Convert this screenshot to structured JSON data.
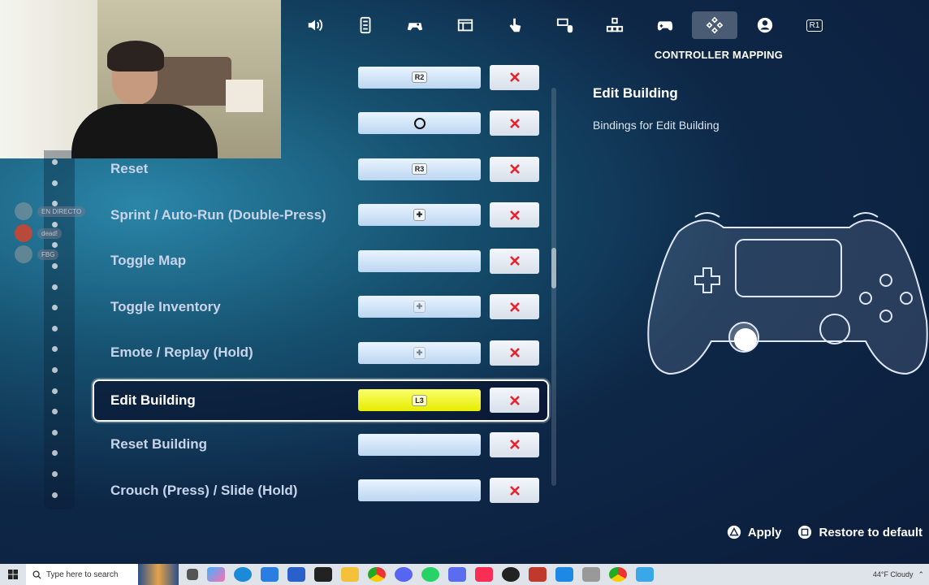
{
  "header": {
    "tab_title": "CONTROLLER MAPPING",
    "tabs": [
      {
        "name": "audio-tab",
        "icon": "speaker-icon"
      },
      {
        "name": "accessibility-tab",
        "icon": "accessibility-icon"
      },
      {
        "name": "input-tab",
        "icon": "gamepad-touch-icon"
      },
      {
        "name": "game-ui-tab",
        "icon": "window-icon"
      },
      {
        "name": "touch-tab",
        "icon": "touch-hand-icon"
      },
      {
        "name": "keyboard-mouse-tab",
        "icon": "keyboard-mouse-icon"
      },
      {
        "name": "hud-tab",
        "icon": "blocks-icon"
      },
      {
        "name": "controller-tab",
        "icon": "gamepad-icon"
      },
      {
        "name": "controller-mapping-tab",
        "icon": "gamepad-mapping-icon",
        "active": true
      },
      {
        "name": "account-tab",
        "icon": "account-icon"
      }
    ],
    "r1_label": "R1"
  },
  "bindings": [
    {
      "label": "",
      "key": "R2",
      "key_style": "badge"
    },
    {
      "label": "",
      "key": "",
      "key_style": "circle"
    },
    {
      "label": "Reset",
      "key": "R3",
      "key_style": "badge"
    },
    {
      "label": "Sprint / Auto-Run (Double-Press)",
      "key": "",
      "key_style": "dpad"
    },
    {
      "label": "Toggle Map",
      "key": "",
      "key_style": "none"
    },
    {
      "label": "Toggle Inventory",
      "key": "",
      "key_style": "dpad-faint"
    },
    {
      "label": "Emote / Replay (Hold)",
      "key": "",
      "key_style": "dpad-faint"
    },
    {
      "label": "Edit Building",
      "key": "L3",
      "key_style": "badge",
      "selected": true
    },
    {
      "label": "Reset Building",
      "key": "",
      "key_style": "none"
    },
    {
      "label": "Crouch (Press) / Slide (Hold)",
      "key": "",
      "key_style": "none"
    }
  ],
  "info": {
    "title": "Edit Building",
    "description": "Bindings for Edit Building"
  },
  "actions": {
    "apply": "Apply",
    "restore": "Restore to default"
  },
  "overlay": {
    "chat1": "EN DIRECTO",
    "chat2": "dead!",
    "chat3": "FBG"
  },
  "taskbar": {
    "search_placeholder": "Type here to search",
    "weather": "44°F  Cloudy"
  },
  "colors": {
    "selected_binding": "#e6ec00",
    "binding": "#bcd6f1",
    "remove_x": "#e8242e"
  }
}
